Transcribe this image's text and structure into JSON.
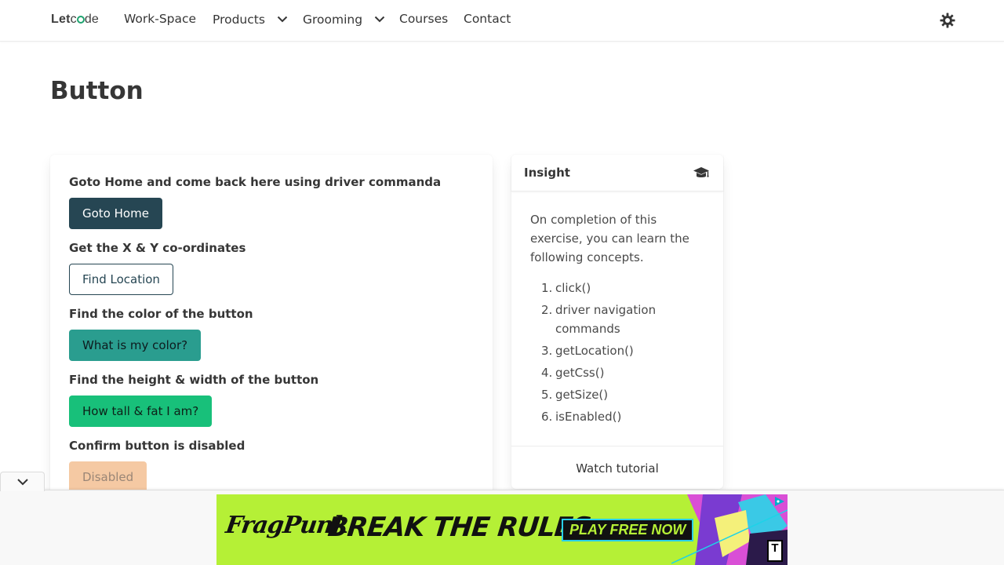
{
  "navbar": {
    "logo": {
      "part1": "Let",
      "part2_before": "c",
      "part2_after": "de"
    },
    "items": [
      {
        "label": "Work-Space"
      },
      {
        "label": "Products"
      },
      {
        "label": "Grooming"
      },
      {
        "label": "Courses"
      },
      {
        "label": "Contact"
      }
    ],
    "theme_icon": "sun-gear-icon"
  },
  "page": {
    "title": "Button"
  },
  "exercises": [
    {
      "label": "Goto Home and come back here using driver commanda",
      "button": "Goto Home"
    },
    {
      "label": "Get the X & Y co-ordinates",
      "button": "Find Location"
    },
    {
      "label": "Find the color of the button",
      "button": "What is my color?"
    },
    {
      "label": "Find the height & width of the button",
      "button": "How tall & fat I am?"
    },
    {
      "label": "Confirm button is disabled",
      "button": "Disabled"
    }
  ],
  "colors": {
    "goto_home": "#264653",
    "find_location_border": "#264653",
    "what_color": "#2a9d8f",
    "how_tall": "#18c07a",
    "disabled": "#f5c9a3"
  },
  "insight": {
    "title": "Insight",
    "icon": "graduation-cap-icon",
    "description": "On completion of this exercise, you can learn the following concepts.",
    "concepts": [
      {
        "num": "1.",
        "text": "click()"
      },
      {
        "num": "2.",
        "text": "driver navigation commands"
      },
      {
        "num": "3.",
        "text": "getLocation()"
      },
      {
        "num": "4.",
        "text": "getCss()"
      },
      {
        "num": "5.",
        "text": "getSize()"
      },
      {
        "num": "6.",
        "text": "isEnabled()"
      }
    ],
    "footer_link": "Watch tutorial"
  },
  "ad": {
    "wordmark": "FragPunk",
    "headline": "BREAK THE RULES",
    "cta": "PLAY FREE NOW",
    "rating": "T"
  }
}
